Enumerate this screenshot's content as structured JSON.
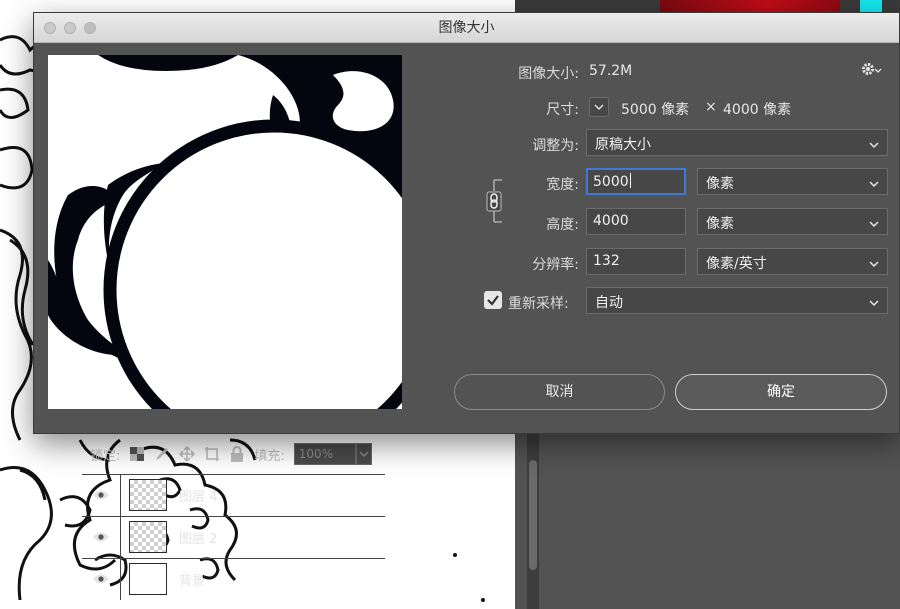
{
  "dialog": {
    "title": "图像大小",
    "image_size_label": "图像大小:",
    "image_size_value": "57.2M",
    "dimensions_label": "尺寸:",
    "dimensions_width": "5000 像素",
    "dimensions_sep": "×",
    "dimensions_height": "4000 像素",
    "fit_to_label": "调整为:",
    "fit_to_value": "原稿大小",
    "width_label": "宽度:",
    "width_value": "5000",
    "width_unit": "像素",
    "height_label": "高度:",
    "height_value": "4000",
    "height_unit": "像素",
    "resolution_label": "分辨率:",
    "resolution_value": "132",
    "resolution_unit": "像素/英寸",
    "resample_label": "重新采样:",
    "resample_checked": true,
    "resample_value": "自动",
    "cancel_label": "取消",
    "ok_label": "确定"
  },
  "layers_panel": {
    "lock_label": "锁定:",
    "fill_label": "填充:",
    "fill_value": "100%",
    "layers": [
      {
        "name": "图层 4",
        "thumb": "checker"
      },
      {
        "name": "图层 2",
        "thumb": "checker"
      },
      {
        "name": "背景",
        "thumb": "white"
      }
    ]
  },
  "colors": {
    "dialog_bg": "#535353",
    "focus_ring": "#3d7ad6",
    "swatch_red": "#c10d16",
    "swatch_cyan": "#16e6ef"
  },
  "icons": [
    "gear-icon",
    "chain-link-icon",
    "chevron-down-icon",
    "checkmark-icon",
    "eye-icon",
    "lock-icon",
    "brush-icon",
    "move-icon",
    "crop-icon",
    "transparency-lock-icon"
  ]
}
